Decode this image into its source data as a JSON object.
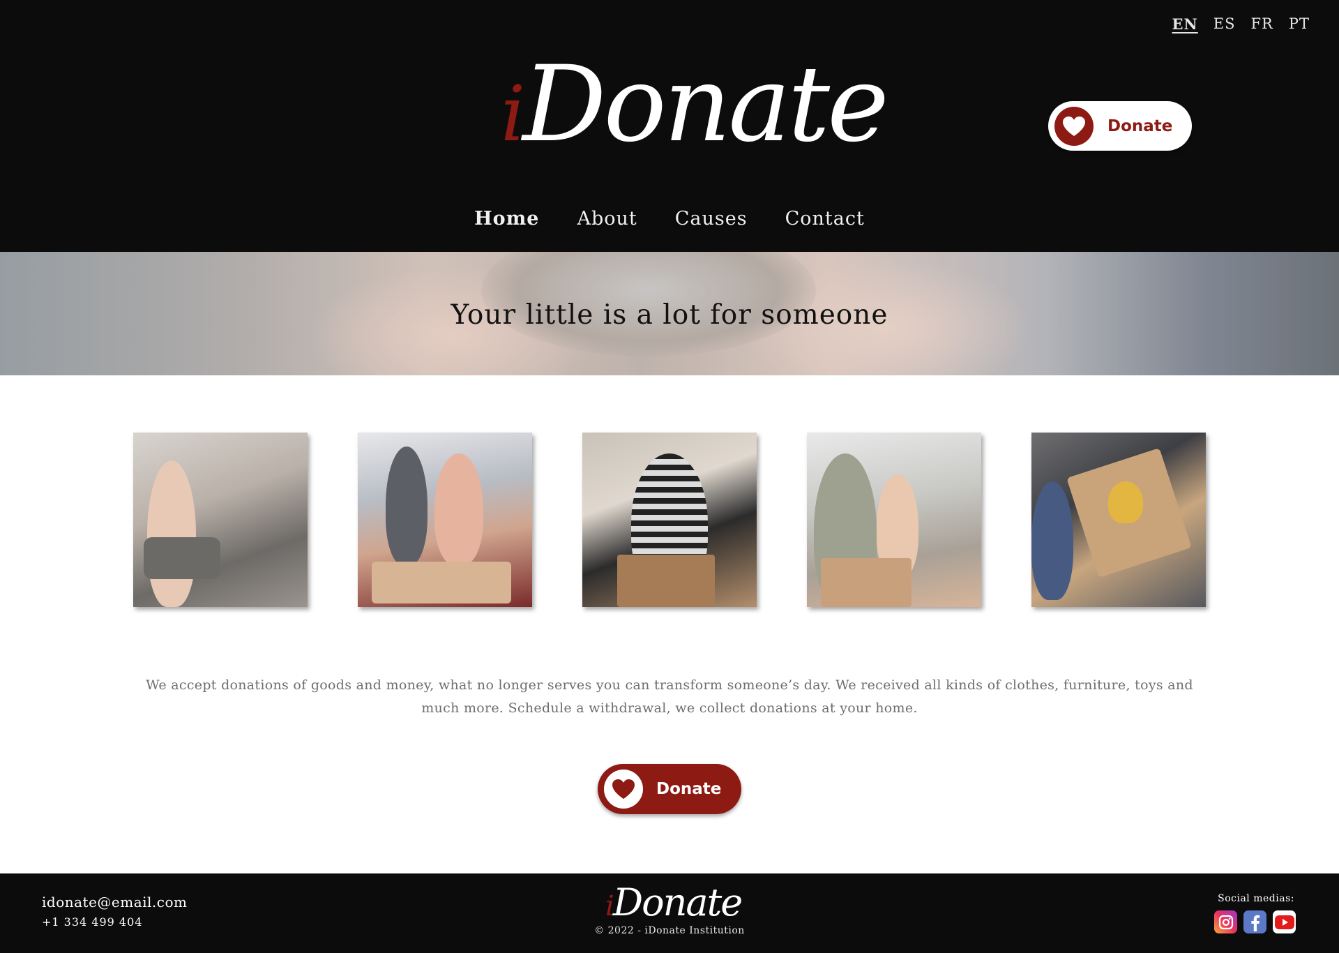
{
  "languages": [
    "EN",
    "ES",
    "FR",
    "PT"
  ],
  "brand": {
    "i": "i",
    "rest": "Donate",
    "accent_color": "#8e1a14",
    "dark_bg": "#0c0c0d"
  },
  "header": {
    "donate_label": "Donate"
  },
  "nav": {
    "home": "Home",
    "about": "About",
    "causes": "Causes",
    "contact": "Contact"
  },
  "hero": {
    "title": "Your little is a lot for someone"
  },
  "photos": [
    {
      "icon": "volunteer-holding-clothes-photo"
    },
    {
      "icon": "volunteers-team-hands-photo"
    },
    {
      "icon": "volunteer-with-box-photo"
    },
    {
      "icon": "volunteers-packing-boxes-photo"
    },
    {
      "icon": "donation-box-handover-photo"
    }
  ],
  "main": {
    "description": "We accept donations of goods and money, what no longer serves you can transform someone’s day. We received all kinds of clothes, furniture, toys and much more. Schedule a withdrawal, we collect donations at your home.",
    "donate_label": "Donate"
  },
  "footer": {
    "email": "idonate@email.com",
    "phone": "+1 334 499 404",
    "copyright": "© 2022 - iDonate Institution",
    "social_label": "Social medias:",
    "social_icons": [
      "instagram-icon",
      "facebook-icon",
      "youtube-icon"
    ]
  }
}
